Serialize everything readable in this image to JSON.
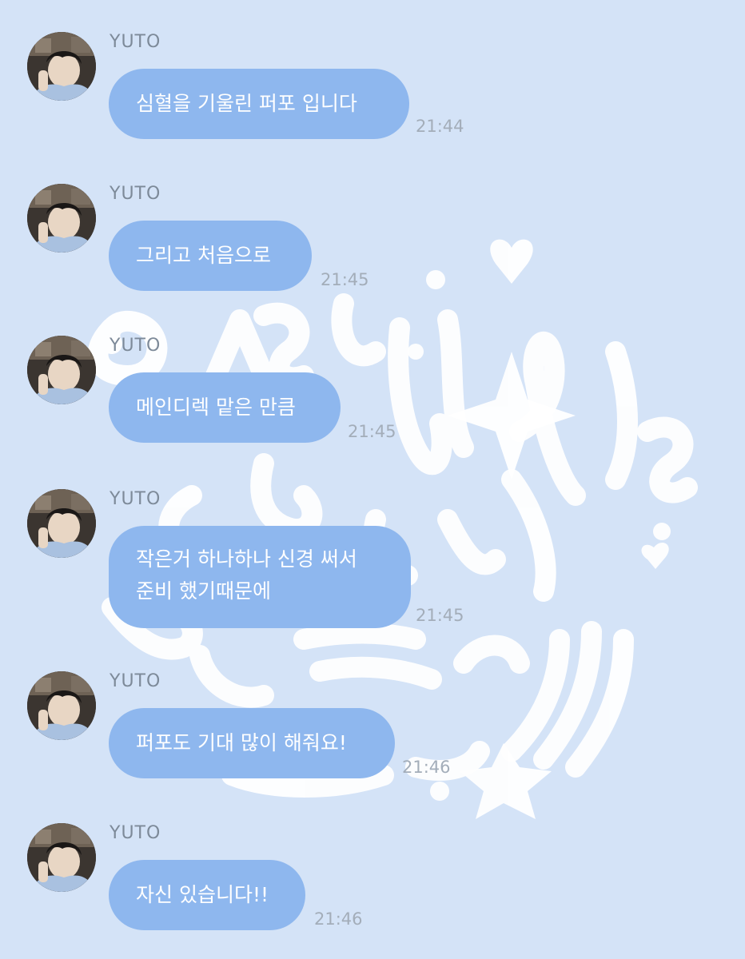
{
  "chat": {
    "messages": [
      {
        "sender": "YUTO",
        "lines": [
          "심혈을 기울린 퍼포 입니다"
        ],
        "time": "21:44"
      },
      {
        "sender": "YUTO",
        "lines": [
          "그리고 처음으로"
        ],
        "time": "21:45"
      },
      {
        "sender": "YUTO",
        "lines": [
          "메인디렉 맡은 만큼"
        ],
        "time": "21:45"
      },
      {
        "sender": "YUTO",
        "lines": [
          "작은거 하나하나 신경 써서",
          "준비 했기때문에"
        ],
        "time": "21:45"
      },
      {
        "sender": "YUTO",
        "lines": [
          "퍼포도 기대 많이 해줘요!"
        ],
        "time": "21:46"
      },
      {
        "sender": "YUTO",
        "lines": [
          "자신 있습니다!!"
        ],
        "time": "21:46"
      }
    ]
  },
  "colors": {
    "background": "#d4e3f7",
    "bubble": "#8eb7ee",
    "bubble_text": "#ffffff",
    "sender_text": "#7d8a99",
    "time_text": "#a3adb9",
    "doodle": "#ffffff"
  }
}
